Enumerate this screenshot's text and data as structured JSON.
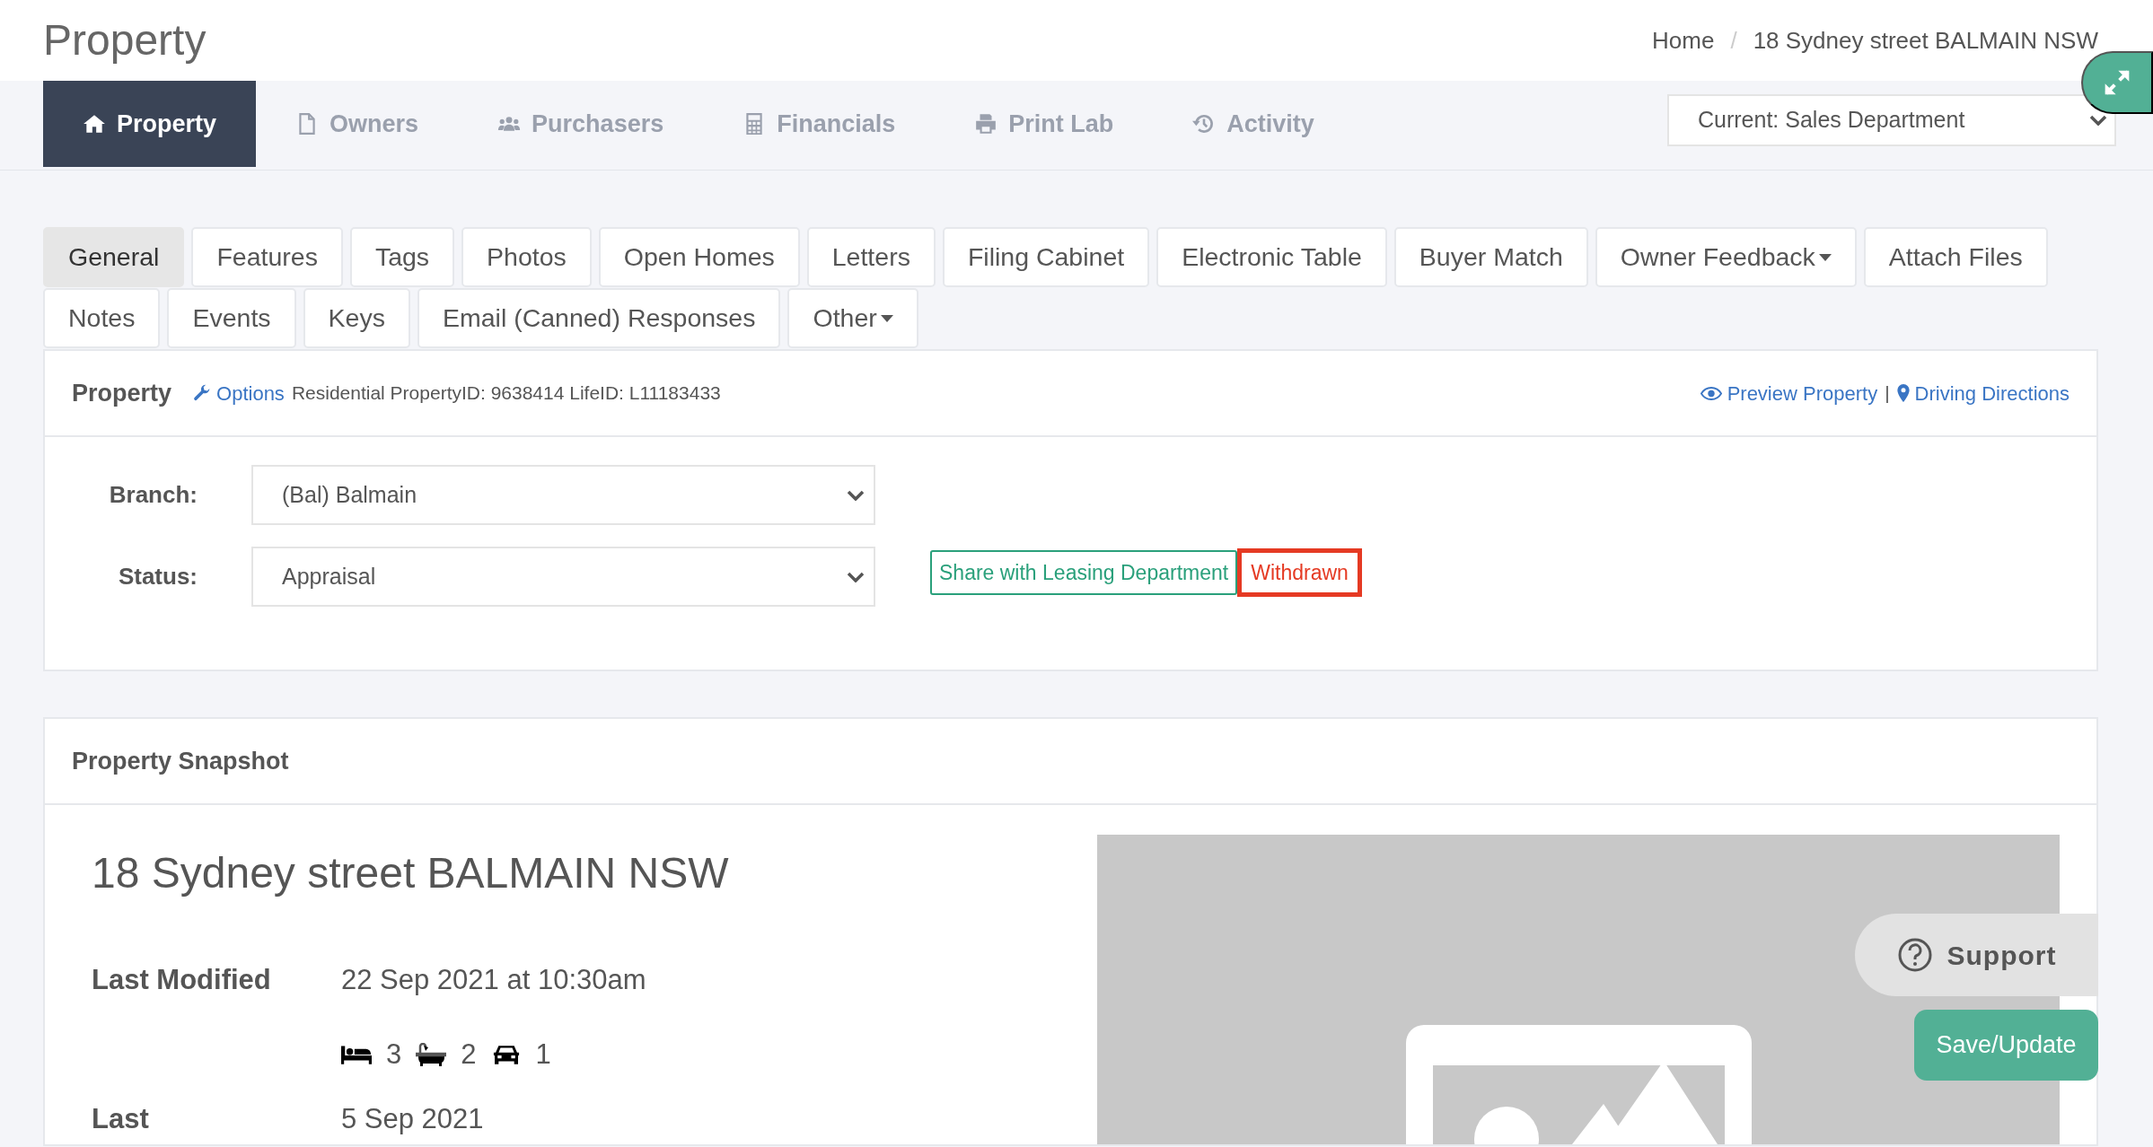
{
  "page_title": "Property",
  "breadcrumb": [
    {
      "label": "Home"
    },
    {
      "label": "18 Sydney street BALMAIN NSW"
    }
  ],
  "breadcrumb_separator": "/",
  "main_tabs": [
    {
      "label": "Property",
      "selected": true
    },
    {
      "label": "Owners",
      "selected": false
    },
    {
      "label": "Purchasers",
      "selected": false
    },
    {
      "label": "Financials",
      "selected": false
    },
    {
      "label": "Print Lab",
      "selected": false
    },
    {
      "label": "Activity",
      "selected": false
    }
  ],
  "department_select": {
    "value": "Current: Sales Department"
  },
  "sub_tabs": [
    {
      "label": "General",
      "selected": true,
      "dropdown": false
    },
    {
      "label": "Features",
      "selected": false,
      "dropdown": false
    },
    {
      "label": "Tags",
      "selected": false,
      "dropdown": false
    },
    {
      "label": "Photos",
      "selected": false,
      "dropdown": false
    },
    {
      "label": "Open Homes",
      "selected": false,
      "dropdown": false
    },
    {
      "label": "Letters",
      "selected": false,
      "dropdown": false
    },
    {
      "label": "Filing Cabinet",
      "selected": false,
      "dropdown": false
    },
    {
      "label": "Electronic Table",
      "selected": false,
      "dropdown": false
    },
    {
      "label": "Buyer Match",
      "selected": false,
      "dropdown": false
    },
    {
      "label": "Owner Feedback",
      "selected": false,
      "dropdown": true
    },
    {
      "label": "Attach Files",
      "selected": false,
      "dropdown": false
    },
    {
      "label": "Notes",
      "selected": false,
      "dropdown": false
    },
    {
      "label": "Events",
      "selected": false,
      "dropdown": false
    },
    {
      "label": "Keys",
      "selected": false,
      "dropdown": false
    },
    {
      "label": "Email (Canned) Responses",
      "selected": false,
      "dropdown": false
    },
    {
      "label": "Other",
      "selected": false,
      "dropdown": true
    }
  ],
  "property_panel": {
    "title": "Property",
    "options_link": "Options",
    "info": "Residential PropertyID: 9638414 LifeID: L11183433",
    "links": [
      {
        "label": "Preview Property"
      },
      {
        "label": "Driving Directions"
      }
    ],
    "link_separator": "|",
    "fields": [
      {
        "label": "Branch:",
        "value": "(Bal) Balmain"
      },
      {
        "label": "Status:",
        "value": "Appraisal"
      }
    ],
    "status_tags": [
      {
        "label": "Share with Leasing Department",
        "kind": "outline"
      },
      {
        "label": "Withdrawn",
        "kind": "highlighted"
      }
    ]
  },
  "snapshot": {
    "title": "Property Snapshot",
    "address": "18 Sydney street BALMAIN NSW",
    "last_modified": {
      "label": "Last Modified",
      "value": "22 Sep 2021 at 10:30am"
    },
    "features": [
      {
        "count": "3"
      },
      {
        "count": "2"
      },
      {
        "count": "1"
      }
    ],
    "next_row": {
      "label": "Last",
      "value": "5 Sep 2021"
    },
    "image": {
      "kind": "placeholder"
    }
  },
  "support_button": "Support",
  "save_button": "Save/Update"
}
